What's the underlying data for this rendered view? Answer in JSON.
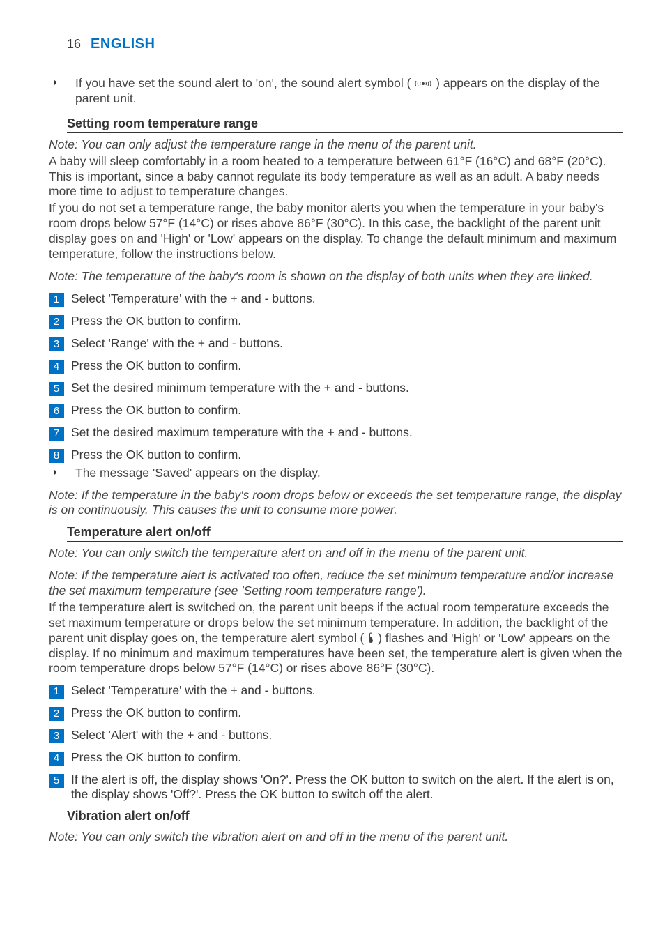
{
  "header": {
    "page_number": "16",
    "language": "ENGLISH"
  },
  "intro_bullet": {
    "pre": "If you have set the sound alert to 'on', the sound alert symbol (",
    "post": ") appears on the display of the parent unit."
  },
  "section1": {
    "heading": "Setting room temperature range",
    "note1": "Note: You can only adjust the temperature range in the menu of the parent unit.",
    "para1": "A baby will sleep comfortably in a room heated to a temperature between 61°F (16°C) and 68°F (20°C). This is important, since a baby cannot regulate its body temperature as well as an adult. A baby needs more time to adjust to temperature changes.",
    "para2": "If you do not set a temperature range, the baby monitor alerts you when the temperature in your baby's room drops below 57°F (14°C) or rises above 86°F (30°C). In this case, the backlight of the parent unit display goes on and 'High' or 'Low' appears on the display. To change the default minimum and maximum temperature, follow the instructions below.",
    "note2": "Note: The temperature of the baby's room is shown on the display of both units when they are linked.",
    "steps": [
      "Select 'Temperature' with the + and - buttons.",
      "Press the OK button to confirm.",
      "Select 'Range' with the + and - buttons.",
      "Press the OK button to confirm.",
      "Set the desired minimum temperature with the + and - buttons.",
      "Press the OK button to confirm.",
      "Set the desired maximum temperature with the + and - buttons.",
      "Press the OK button to confirm."
    ],
    "after_step_bullet": "The message 'Saved' appears on the display.",
    "note3": "Note: If the temperature in the baby's room drops below or exceeds the set temperature range, the display is on continuously. This causes the unit to consume more power."
  },
  "section2": {
    "heading": "Temperature alert on/off",
    "note1": "Note: You can only switch the temperature alert on and off in the menu of  the parent unit.",
    "note2": "Note: If the temperature alert is activated too often, reduce the set minimum temperature and/or increase the set maximum temperature (see 'Setting room temperature range').",
    "para1_pre": "If the temperature alert is switched on, the parent unit beeps if the actual room temperature exceeds the set maximum temperature or drops below the set minimum temperature. In addition, the backlight of the parent unit display goes on, the temperature alert symbol (",
    "para1_post": ") flashes and 'High' or 'Low' appears on the display. If no minimum and maximum temperatures have been set, the temperature alert is given when the room temperature drops below 57°F (14°C) or rises above 86°F (30°C).",
    "steps": [
      "Select 'Temperature' with the + and - buttons.",
      "Press the OK button to confirm.",
      "Select 'Alert' with the + and - buttons.",
      "Press the OK button to confirm.",
      "If the alert is off, the display shows 'On?'. Press the OK button to switch on the alert. If the alert is on, the display shows 'Off?'. Press the OK button to switch off the alert."
    ]
  },
  "section3": {
    "heading": "Vibration alert on/off",
    "note1": "Note: You can only switch the vibration alert on and off in the menu of the parent unit."
  }
}
